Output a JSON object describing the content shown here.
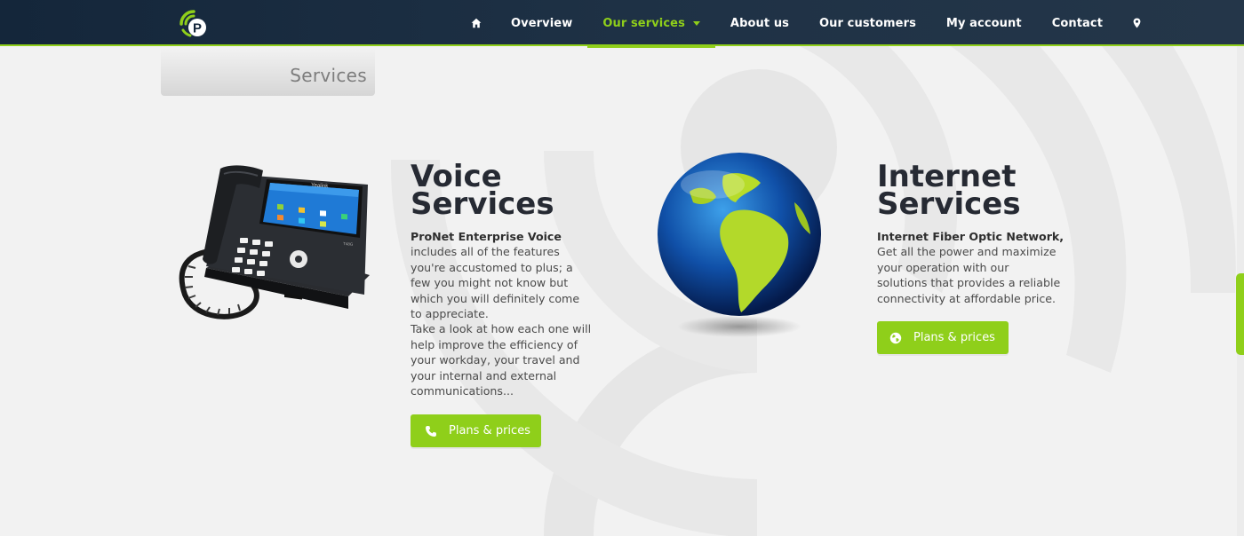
{
  "header": {
    "logo_letter": "P",
    "nav": [
      {
        "label": "Overview"
      },
      {
        "label": "Our services"
      },
      {
        "label": "About us"
      },
      {
        "label": "Our customers"
      },
      {
        "label": "My account"
      },
      {
        "label": "Contact"
      }
    ],
    "icons": [
      "home-icon",
      "chevron-down-icon",
      "map-pin-icon"
    ],
    "accent_color": "#8fcf1a",
    "bar_color": "#1e3145"
  },
  "breadcrumb": {
    "label": "Services"
  },
  "voice": {
    "title_line1": "Voice",
    "title_line2": "Services",
    "lead": "ProNet Enterprise Voice",
    "lines": [
      "includes all of the features",
      "you're accustomed to plus; a",
      "few you might not know but",
      "which you will definitely come",
      "to appreciate.",
      "Take a look at how each one will",
      "help improve the efficiency of",
      "your workday, your travel and",
      "your internal and external",
      "communications..."
    ],
    "button_label": "Plans & prices",
    "button_icon": "phone-icon"
  },
  "internet": {
    "title_line1": "Internet",
    "title_line2": "Services",
    "lead": "Internet Fiber Optic Network,",
    "lines": [
      "Get all the power and maximize",
      "your operation with our",
      "solutions that provides a reliable",
      "connectivity at affordable price."
    ],
    "button_label": "Plans & prices",
    "button_icon": "globe-icon"
  },
  "phone_brand": "Yealink",
  "phone_model": "T48G"
}
